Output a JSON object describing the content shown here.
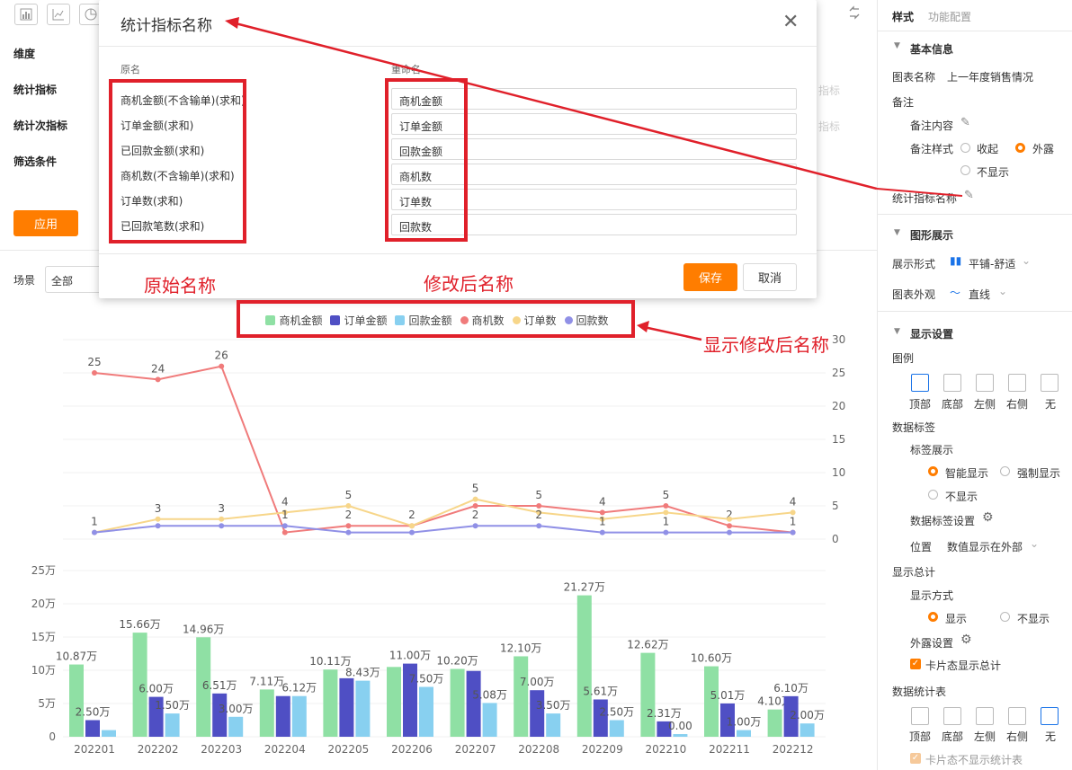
{
  "toolbar": {
    "icons": [
      "bar-chart-icon",
      "line-chart-icon",
      "pie-chart-icon",
      "swap-icon"
    ]
  },
  "left": {
    "dimension_label": "维度",
    "metric_label": "统计指标",
    "sub_metric_label": "统计次指标",
    "filter_label": "筛选条件",
    "apply_label": "应用",
    "scene_label": "场景",
    "scene_value": "全部",
    "faded_metric": "指标",
    "faded_sub_metric": "指标"
  },
  "dialog": {
    "title": "统计指标名称",
    "orig_header": "原名",
    "rename_header": "重命名",
    "rows": [
      {
        "orig": "商机金额(不含输单)(求和)",
        "rename": "商机金额"
      },
      {
        "orig": "订单金额(求和)",
        "rename": "订单金额"
      },
      {
        "orig": "已回款金额(求和)",
        "rename": "回款金额"
      },
      {
        "orig": "商机数(不含输单)(求和)",
        "rename": "商机数"
      },
      {
        "orig": "订单数(求和)",
        "rename": "订单数"
      },
      {
        "orig": "已回款笔数(求和)",
        "rename": "回款数"
      }
    ],
    "save_label": "保存",
    "cancel_label": "取消"
  },
  "annotations": {
    "original": "原始名称",
    "renamed": "修改后名称",
    "legend_note": "显示修改后名称"
  },
  "colors": {
    "accent": "#ff7d00",
    "annot_red": "#e0202a",
    "s_green": "#8fe0a4",
    "s_blue": "#4f4fc4",
    "s_light": "#88d0f0",
    "s_red": "#f07b7b",
    "s_yellow": "#f7d68a",
    "s_purple": "#9090e6"
  },
  "right_panel": {
    "tab_style": "样式",
    "tab_function": "功能配置",
    "basic_info": "基本信息",
    "chart_name_label": "图表名称",
    "chart_name_value": "上一年度销售情况",
    "remark_label": "备注",
    "remark_content_label": "备注内容",
    "remark_style_label": "备注样式",
    "remark_style_options": [
      "收起",
      "外露",
      "不显示"
    ],
    "metric_name_label": "统计指标名称",
    "graphic_display": "图形展示",
    "display_form_label": "展示形式",
    "display_form_value": "平铺-舒适",
    "appearance_label": "图表外观",
    "appearance_value": "直线",
    "display_settings": "显示设置",
    "legend_label": "图例",
    "legend_positions": [
      "顶部",
      "底部",
      "左侧",
      "右侧",
      "无"
    ],
    "data_label": "数据标签",
    "label_display": "标签展示",
    "label_options": [
      "智能显示",
      "强制显示",
      "不显示"
    ],
    "data_label_settings": "数据标签设置",
    "position_label": "位置",
    "position_value": "数值显示在外部",
    "show_total": "显示总计",
    "show_mode": "显示方式",
    "show_options": [
      "显示",
      "不显示"
    ],
    "exposure_settings": "外露设置",
    "card_total": "卡片态显示总计",
    "data_table": "数据统计表",
    "table_positions": [
      "顶部",
      "底部",
      "左侧",
      "右侧",
      "无"
    ],
    "card_no_table": "卡片态不显示统计表"
  },
  "chart_data": [
    {
      "type": "line",
      "x": [
        "202201",
        "202202",
        "202203",
        "202204",
        "202205",
        "202206",
        "202207",
        "202208",
        "202209",
        "202210",
        "202211",
        "202212"
      ],
      "ylim": [
        0,
        30
      ],
      "y_ticks": [
        "0",
        "5",
        "10",
        "15",
        "20",
        "25",
        "30"
      ],
      "series": [
        {
          "name": "商机数",
          "values": [
            25,
            24,
            26,
            1,
            2,
            2,
            5,
            5,
            4,
            5,
            2,
            1
          ],
          "labels": [
            "25",
            "24",
            "26",
            "",
            "2",
            "2",
            "",
            "5",
            "4",
            "5",
            "2",
            ""
          ]
        },
        {
          "name": "订单数",
          "values": [
            1,
            3,
            3,
            4,
            5,
            2,
            6,
            4,
            3,
            4,
            3,
            4
          ],
          "labels": [
            "",
            "3",
            "3",
            "4",
            "5",
            "",
            "5",
            "",
            "",
            "",
            "",
            "4"
          ]
        },
        {
          "name": "回款数",
          "values": [
            1,
            2,
            2,
            2,
            1,
            1,
            2,
            2,
            1,
            1,
            1,
            1
          ],
          "labels": [
            "1",
            "",
            "",
            "1",
            "",
            "",
            "2",
            "2",
            "1",
            "1",
            "",
            "1"
          ]
        }
      ]
    },
    {
      "type": "bar",
      "categories": [
        "202201",
        "202202",
        "202203",
        "202204",
        "202205",
        "202206",
        "202207",
        "202208",
        "202209",
        "202210",
        "202211",
        "202212"
      ],
      "ylim": [
        0,
        25
      ],
      "y_ticks": [
        "0",
        "5万",
        "10万",
        "15万",
        "20万",
        "25万"
      ],
      "series": [
        {
          "name": "商机金额",
          "values": [
            10.87,
            15.66,
            14.96,
            7.11,
            10.11,
            10.5,
            10.2,
            12.1,
            21.27,
            12.62,
            10.6,
            4.1
          ],
          "labels": [
            "10.87万",
            "15.66万",
            "14.96万",
            "7.11万",
            "10.11万",
            "",
            "10.20万",
            "12.10万",
            "21.27万",
            "12.62万",
            "10.60万",
            "4.10万"
          ]
        },
        {
          "name": "订单金额",
          "values": [
            2.5,
            6.0,
            6.51,
            6.12,
            8.8,
            11.0,
            9.9,
            7.0,
            5.61,
            2.31,
            5.01,
            6.1
          ],
          "labels": [
            "2.50万",
            "6.00万",
            "6.51万",
            "",
            "",
            "11.00万",
            "",
            "7.00万",
            "5.61万",
            "2.31万",
            "5.01万",
            "6.10万"
          ]
        },
        {
          "name": "回款金额",
          "values": [
            1.0,
            3.5,
            3.0,
            6.12,
            8.43,
            7.5,
            5.08,
            3.5,
            2.5,
            0.4,
            1.0,
            2.0
          ],
          "labels": [
            "",
            "1.50万",
            "3.00万",
            "6.12万",
            "8.43万",
            "7.50万",
            "5.08万",
            "3.50万",
            "2.50万",
            "0.00",
            "1.00万",
            "2.00万"
          ]
        }
      ]
    }
  ]
}
